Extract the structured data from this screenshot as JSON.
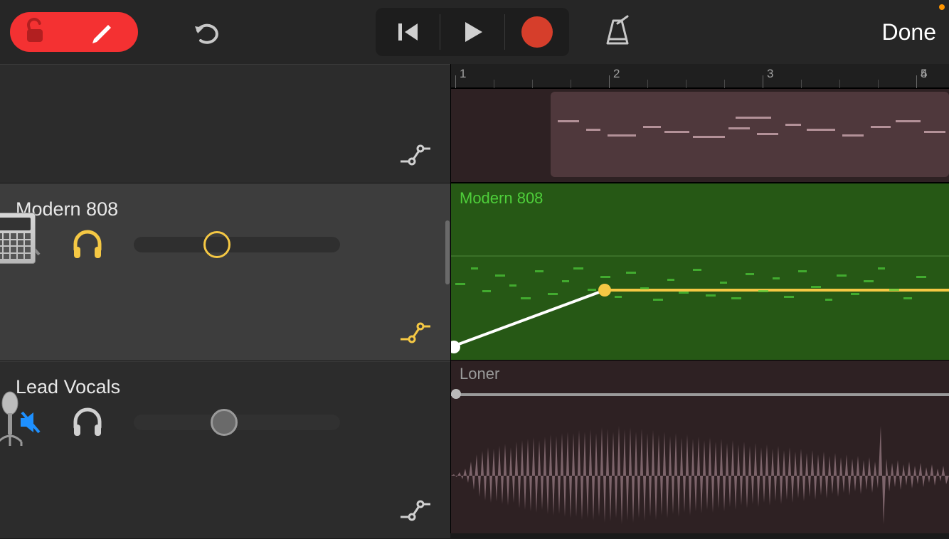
{
  "done_label": "Done",
  "ruler": {
    "bars": [
      "1",
      "2",
      "3",
      "4",
      "5"
    ]
  },
  "tracks": [
    {
      "name": "",
      "muted": false,
      "solo": false,
      "selected": false,
      "region_name": ""
    },
    {
      "name": "Modern 808",
      "muted": true,
      "mute_color": "#9a9a9a",
      "solo": true,
      "solo_color": "#f5c844",
      "vol_position": 0.38,
      "selected": true,
      "instrument": "drum-machine",
      "automation_active": true,
      "region_name": "Modern 808"
    },
    {
      "name": "Lead Vocals",
      "muted": true,
      "mute_color": "#1e90ff",
      "solo": false,
      "solo_color": "#d0d0d0",
      "vol_position": 0.4,
      "selected": false,
      "instrument": "microphone",
      "automation_active": false,
      "region_name": "Loner"
    }
  ],
  "colors": {
    "accent_red": "#f43132",
    "accent_yellow": "#f5c844",
    "accent_green": "#4ecf3a",
    "accent_blue": "#1e90ff",
    "record_red": "#d63e2b"
  }
}
